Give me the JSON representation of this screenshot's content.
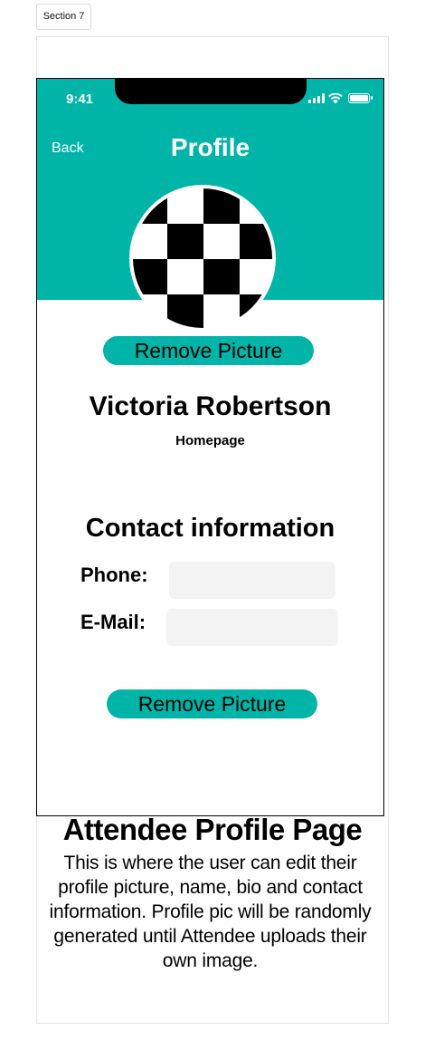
{
  "section_tag": "Section 7",
  "status_bar": {
    "time": "9:41"
  },
  "nav": {
    "back_label": "Back",
    "title": "Profile"
  },
  "profile": {
    "remove_picture_label": "Remove Picture",
    "name": "Victoria Robertson",
    "homepage": "Homepage"
  },
  "contact": {
    "heading": "Contact information",
    "phone_label": "Phone:",
    "phone_value": "",
    "email_label": "E-Mail:",
    "email_value": ""
  },
  "bottom_button_label": "Remove Picture",
  "caption": {
    "title": "Attendee Profile Page",
    "text": "This is where the user can edit their profile picture, name, bio and contact information. Profile pic will be randomly generated until Attendee uploads their own image."
  },
  "colors": {
    "accent": "#00b5a8",
    "field_bg": "#f3f3f3"
  },
  "icons": [
    "signal-icon",
    "wifi-icon",
    "battery-icon"
  ]
}
